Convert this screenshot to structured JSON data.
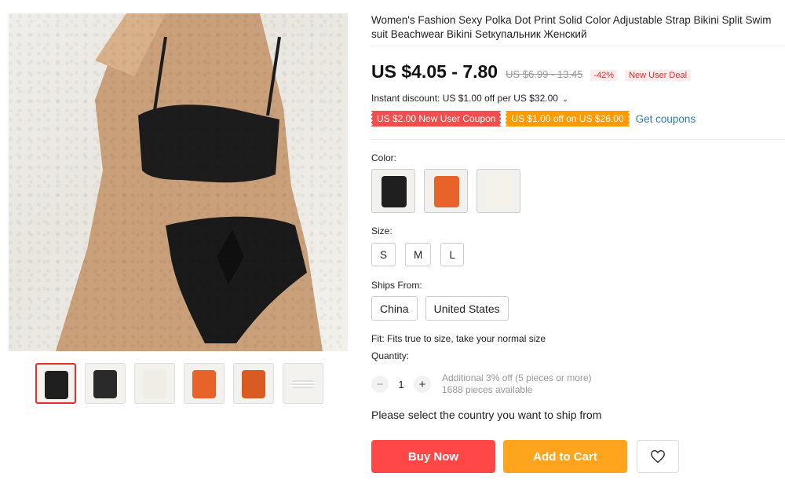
{
  "product": {
    "title": "Women's Fashion Sexy Polka Dot Print Solid Color Adjustable Strap Bikini Split Swim suit Beachwear Bikini Setкупальник Женский",
    "price": "US $4.05 - 7.80",
    "old_price": "US $6.99 - 13.45",
    "discount_pct": "-42%",
    "deal_badge": "New User Deal"
  },
  "discounts": {
    "instant": "Instant discount: US $1.00 off per US $32.00",
    "coupon_1": "US $2.00 New User Coupon",
    "coupon_2": "US $1.00 off on US $26.00",
    "get_coupons": "Get coupons"
  },
  "color": {
    "label": "Color:",
    "options": [
      {
        "name": "black",
        "swatch": "#1f1f1f"
      },
      {
        "name": "orange",
        "swatch": "#e8632a"
      },
      {
        "name": "white-print",
        "swatch": "#f5f2ea"
      }
    ]
  },
  "size": {
    "label": "Size:",
    "options": [
      "S",
      "M",
      "L"
    ]
  },
  "ships_from": {
    "label": "Ships From:",
    "options": [
      "China",
      "United States"
    ]
  },
  "fit": "Fit: Fits true to size, take your normal size",
  "quantity": {
    "label": "Quantity:",
    "minus": "−",
    "plus": "+",
    "value": "1",
    "extra_off": "Additional 3% off (5 pieces or more)",
    "available": "1688 pieces available"
  },
  "ship_message": "Please select the country you want to ship from",
  "buttons": {
    "buy_now": "Buy Now",
    "add_to_cart": "Add to Cart"
  },
  "thumbnails": [
    "#1f1f1f",
    "#2a2a2a",
    "#f0ede6",
    "#e8632a",
    "#d95b22",
    "#ffffff"
  ],
  "colors": {
    "accent_red": "#ff4747",
    "accent_orange": "#ffa41c",
    "link_blue": "#2b7bb9"
  }
}
